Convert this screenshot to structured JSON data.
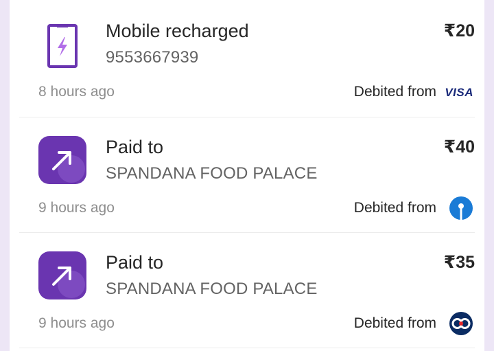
{
  "transactions": [
    {
      "icon": "mobile-recharge-icon",
      "title": "Mobile recharged",
      "subtitle": "9553667939",
      "amount": "₹20",
      "time": "8 hours ago",
      "debited_label": "Debited from",
      "bank": "VISA"
    },
    {
      "icon": "arrow-up-right-icon",
      "title": "Paid to",
      "subtitle": "SPANDANA FOOD PALACE",
      "amount": "₹40",
      "time": "9 hours ago",
      "debited_label": "Debited from",
      "bank": "sbi-logo"
    },
    {
      "icon": "arrow-up-right-icon",
      "title": "Paid to",
      "subtitle": "SPANDANA FOOD PALACE",
      "amount": "₹35",
      "time": "9 hours ago",
      "debited_label": "Debited from",
      "bank": "kotak-logo"
    }
  ],
  "colors": {
    "accent": "#6a35b0",
    "background": "#ede6f6",
    "sbi_blue": "#1a7bd6",
    "kotak_navy": "#0b2c63",
    "kotak_red": "#e4262a"
  }
}
